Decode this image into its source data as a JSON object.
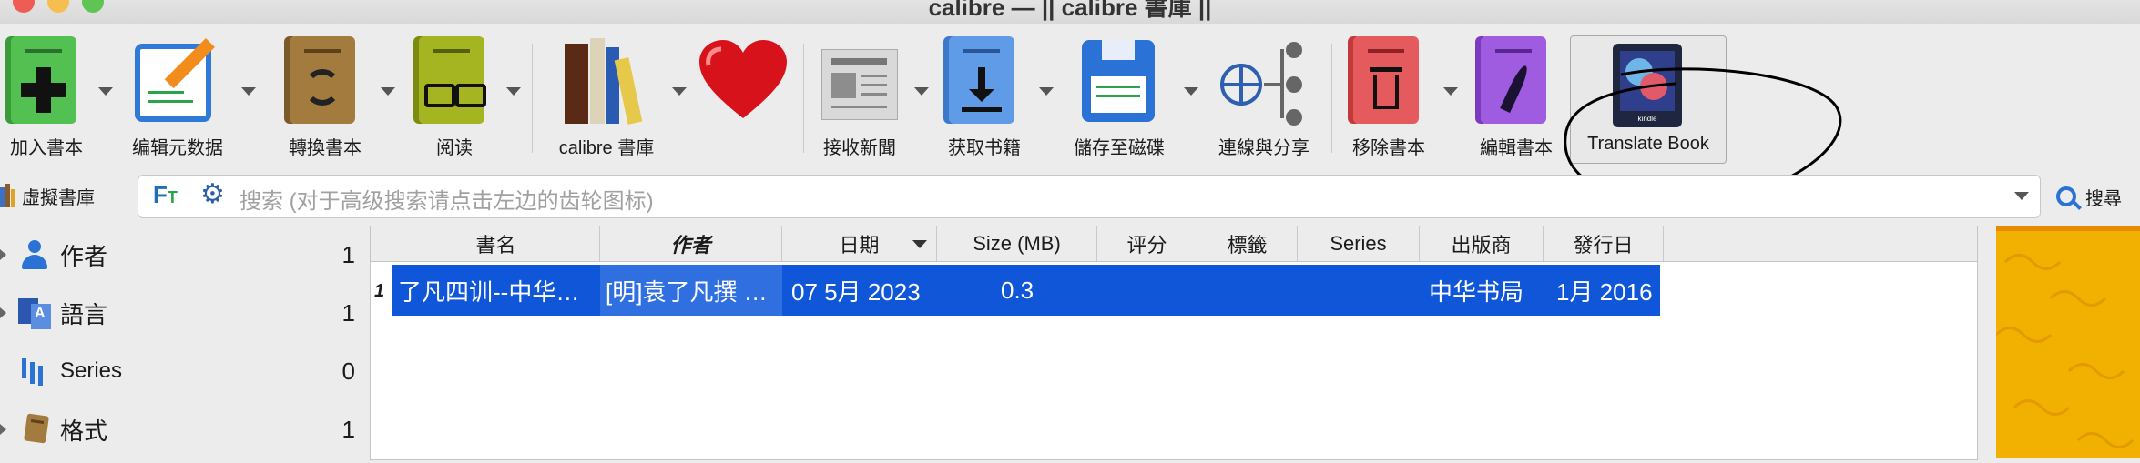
{
  "window": {
    "title": "calibre — || calibre 書庫 ||"
  },
  "toolbar": {
    "items": [
      {
        "label": "加入書本",
        "icon": "add-book-icon"
      },
      {
        "label": "编辑元数据",
        "icon": "edit-metadata-icon"
      },
      {
        "label": "轉換書本",
        "icon": "convert-book-icon"
      },
      {
        "label": "阅读",
        "icon": "read-book-icon"
      },
      {
        "label": "calibre 書庫",
        "icon": "calibre-library-icon"
      },
      {
        "label": "",
        "icon": "heart-donate-icon"
      },
      {
        "label": "接收新聞",
        "icon": "newspaper-icon"
      },
      {
        "label": "获取书籍",
        "icon": "get-books-icon"
      },
      {
        "label": "儲存至磁碟",
        "icon": "save-to-disk-icon"
      },
      {
        "label": "連線與分享",
        "icon": "connect-share-icon"
      },
      {
        "label": "移除書本",
        "icon": "remove-book-icon"
      },
      {
        "label": "編輯書本",
        "icon": "edit-book-icon"
      },
      {
        "label": "Translate Book",
        "icon": "translate-book-icon"
      }
    ],
    "translate_device_text": "kindle"
  },
  "search": {
    "virtual_library_label": "虛擬書庫",
    "placeholder": "搜索 (对于高级搜索请点击左边的齿轮图标)",
    "search_button_label": "搜尋"
  },
  "tag_browser": {
    "items": [
      {
        "label": "作者",
        "count": "1",
        "icon": "person-icon"
      },
      {
        "label": "語言",
        "count": "1",
        "icon": "language-icon"
      },
      {
        "label": "Series",
        "count": "0",
        "icon": "series-icon"
      },
      {
        "label": "格式",
        "count": "1",
        "icon": "format-icon"
      }
    ]
  },
  "book_list": {
    "columns": [
      "書名",
      "作者",
      "日期",
      "Size (MB)",
      "评分",
      "標籤",
      "Series",
      "出版商",
      "發行日"
    ],
    "rows": [
      {
        "num": "1",
        "title": "了凡四训--中华…",
        "author": "[明]袁了凡撰 …",
        "date": "07 5月 2023",
        "size": "0.3",
        "rating": "",
        "tags": "",
        "series": "",
        "publisher": "中华书局",
        "pubdate": "1月 2016"
      }
    ],
    "sort_column": "日期"
  },
  "colors": {
    "selection": "#0f56d9",
    "annotation": "#000000"
  }
}
